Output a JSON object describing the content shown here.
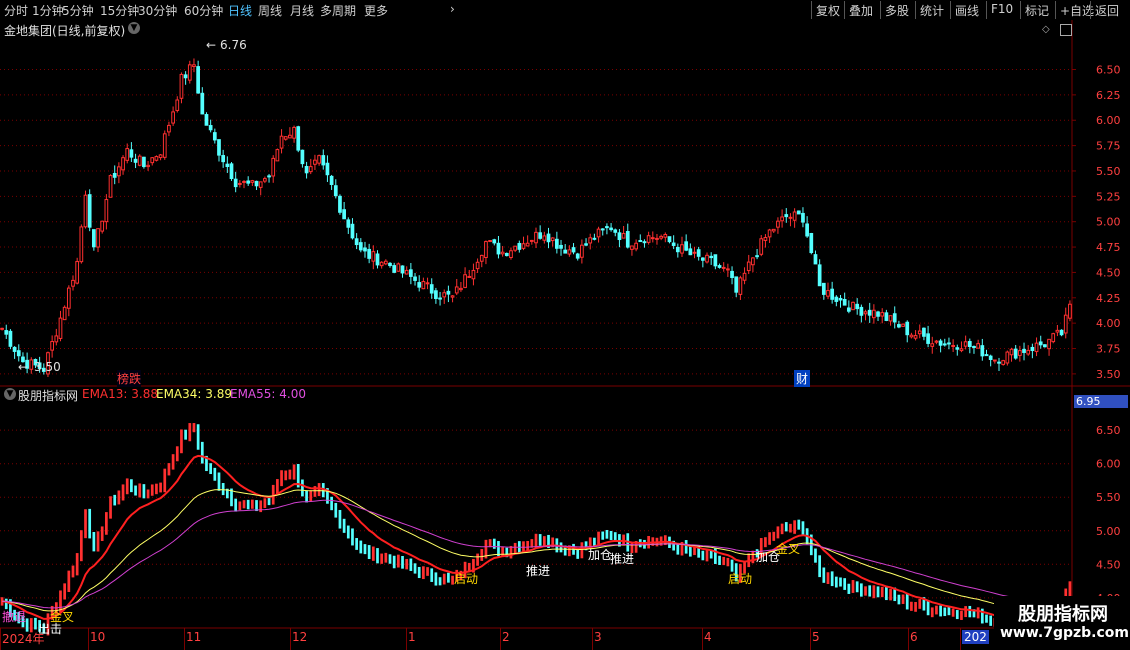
{
  "toolbar": {
    "periods": [
      "分时",
      "1分钟",
      "5分钟",
      "15分钟",
      "30分钟",
      "60分钟",
      "日线",
      "周线",
      "月线",
      "多周期",
      "更多"
    ],
    "active_period": "日线",
    "right_buttons": [
      "复权",
      "叠加",
      "多股",
      "统计",
      "画线",
      "F10",
      "标记",
      "+自选",
      "返回"
    ]
  },
  "main_panel": {
    "title": "金地集团(日线,前复权)",
    "high_label": "6.76",
    "low_label": "3.50",
    "marker_left": "榜跌",
    "marker_right": "财"
  },
  "indicator_panel": {
    "name": "股朋指标网",
    "ema13_label": "EMA13: 3.88",
    "ema34_label": "EMA34: 3.89",
    "ema55_label": "EMA55: 4.00",
    "top_value": "6.95",
    "signals": [
      {
        "text": "启动",
        "color": "#ffd700"
      },
      {
        "text": "推进",
        "color": "#ffffff"
      },
      {
        "text": "加仓",
        "color": "#ffffff"
      },
      {
        "text": "推进",
        "color": "#ffffff"
      },
      {
        "text": "启动",
        "color": "#ffd700"
      },
      {
        "text": "加仓",
        "color": "#ffffff"
      },
      {
        "text": "金叉",
        "color": "#ffd700"
      },
      {
        "text": "金叉",
        "color": "#ffd700"
      },
      {
        "text": "出击",
        "color": "#ffffff"
      },
      {
        "text": "撤退",
        "color": "#ff4fd8"
      }
    ]
  },
  "colors": {
    "up": "#ff3030",
    "down": "#54ffff",
    "ema13": "#ff2020",
    "ema34": "#ffff66",
    "ema55": "#d040d0",
    "grid": "#7a0000"
  },
  "x_axis": {
    "labels": [
      "2024年",
      "10",
      "11",
      "12",
      "1",
      "2",
      "3",
      "4",
      "5",
      "6",
      "202"
    ]
  },
  "watermark": {
    "title": "股朋指标网",
    "url": "www.7gpzb.com"
  },
  "chart_data": {
    "type": "candlestick",
    "price_axis": {
      "ticks": [
        "6.50",
        "6.25",
        "6.00",
        "5.75",
        "5.50",
        "5.25",
        "5.00",
        "4.75",
        "4.50",
        "4.25",
        "4.00",
        "3.75",
        "3.50"
      ],
      "range": [
        3.42,
        6.85
      ]
    },
    "indicator_axis": {
      "ticks": [
        "6.50",
        "6.00",
        "5.50",
        "5.00",
        "4.50",
        "4.00"
      ],
      "range": [
        3.55,
        6.95
      ]
    },
    "anchors": [
      [
        0,
        3.95
      ],
      [
        5,
        3.62
      ],
      [
        10,
        3.55
      ],
      [
        14,
        4.05
      ],
      [
        18,
        4.6
      ],
      [
        20,
        5.3
      ],
      [
        22,
        4.7
      ],
      [
        26,
        5.4
      ],
      [
        30,
        5.7
      ],
      [
        34,
        5.55
      ],
      [
        38,
        5.7
      ],
      [
        41,
        6.1
      ],
      [
        43,
        6.4
      ],
      [
        46,
        6.55
      ],
      [
        48,
        6.05
      ],
      [
        52,
        5.7
      ],
      [
        56,
        5.4
      ],
      [
        60,
        5.35
      ],
      [
        64,
        5.45
      ],
      [
        67,
        5.85
      ],
      [
        70,
        5.9
      ],
      [
        73,
        5.45
      ],
      [
        76,
        5.6
      ],
      [
        79,
        5.35
      ],
      [
        82,
        5.05
      ],
      [
        86,
        4.7
      ],
      [
        92,
        4.6
      ],
      [
        98,
        4.45
      ],
      [
        104,
        4.3
      ],
      [
        108,
        4.25
      ],
      [
        112,
        4.5
      ],
      [
        116,
        4.8
      ],
      [
        120,
        4.7
      ],
      [
        125,
        4.8
      ],
      [
        130,
        4.9
      ],
      [
        134,
        4.75
      ],
      [
        138,
        4.7
      ],
      [
        142,
        4.85
      ],
      [
        146,
        4.95
      ],
      [
        150,
        4.8
      ],
      [
        154,
        4.85
      ],
      [
        158,
        4.85
      ],
      [
        162,
        4.75
      ],
      [
        166,
        4.65
      ],
      [
        170,
        4.6
      ],
      [
        174,
        4.5
      ],
      [
        176,
        4.3
      ],
      [
        180,
        4.65
      ],
      [
        184,
        4.9
      ],
      [
        188,
        5.05
      ],
      [
        192,
        5.05
      ],
      [
        194,
        4.7
      ],
      [
        196,
        4.35
      ],
      [
        200,
        4.25
      ],
      [
        204,
        4.15
      ],
      [
        210,
        4.1
      ],
      [
        214,
        4.0
      ],
      [
        218,
        3.9
      ],
      [
        222,
        3.85
      ],
      [
        226,
        3.8
      ],
      [
        230,
        3.8
      ],
      [
        234,
        3.75
      ],
      [
        238,
        3.65
      ],
      [
        242,
        3.7
      ],
      [
        246,
        3.75
      ],
      [
        250,
        3.8
      ],
      [
        254,
        3.9
      ],
      [
        256,
        4.15
      ]
    ],
    "bars": 257,
    "ema_periods": [
      13,
      34,
      55
    ]
  }
}
